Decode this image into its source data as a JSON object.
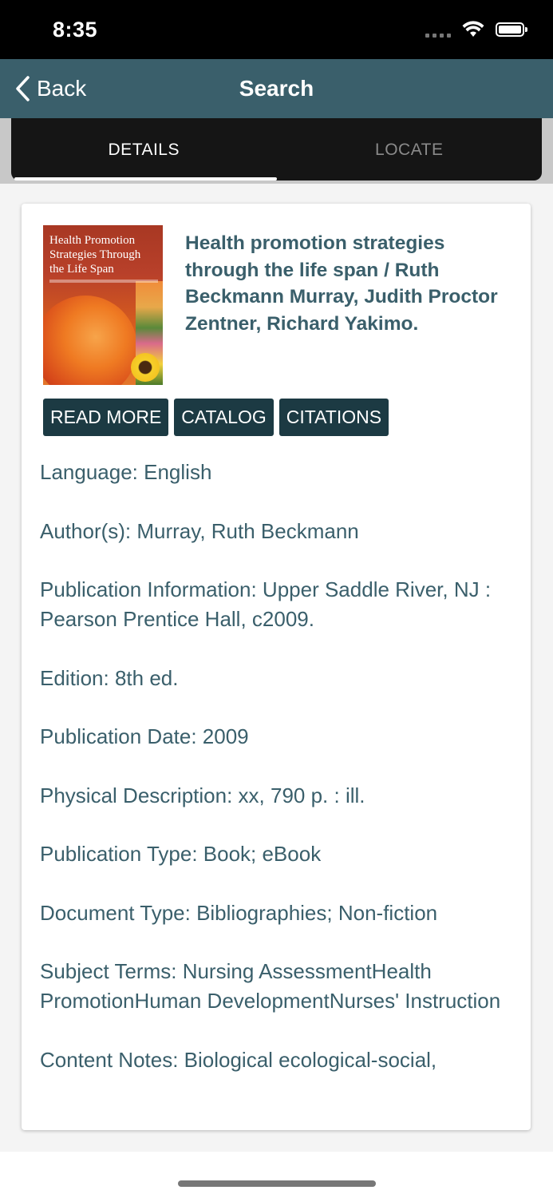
{
  "status_bar": {
    "time": "8:35"
  },
  "nav": {
    "back_label": "Back",
    "title": "Search"
  },
  "tabs": [
    {
      "label": "DETAILS",
      "active": true
    },
    {
      "label": "LOCATE",
      "active": false
    }
  ],
  "book": {
    "cover_title": "Health Promotion Strategies Through the Life Span",
    "title": "Health promotion strategies through the life span / Ruth Beckmann Murray, Judith Proctor Zentner, Richard Yakimo."
  },
  "actions": {
    "read_more": "READ MORE",
    "catalog": "CATALOG",
    "citations": "CITATIONS"
  },
  "details": [
    "Language: English",
    "Author(s): Murray, Ruth Beckmann",
    "Publication Information: Upper Saddle River, NJ : Pearson Prentice Hall, c2009.",
    "Edition: 8th ed.",
    "Publication Date: 2009",
    "Physical Description: xx, 790 p. : ill.",
    "Publication Type: Book; eBook",
    "Document Type: Bibliographies; Non-fiction",
    "Subject Terms: Nursing AssessmentHealth PromotionHuman DevelopmentNurses' Instruction",
    "Content Notes: Biological ecological-social,"
  ],
  "colors": {
    "nav_bg": "#3a5f6b",
    "button_bg": "#1c3a43",
    "text": "#3a5f6b"
  }
}
